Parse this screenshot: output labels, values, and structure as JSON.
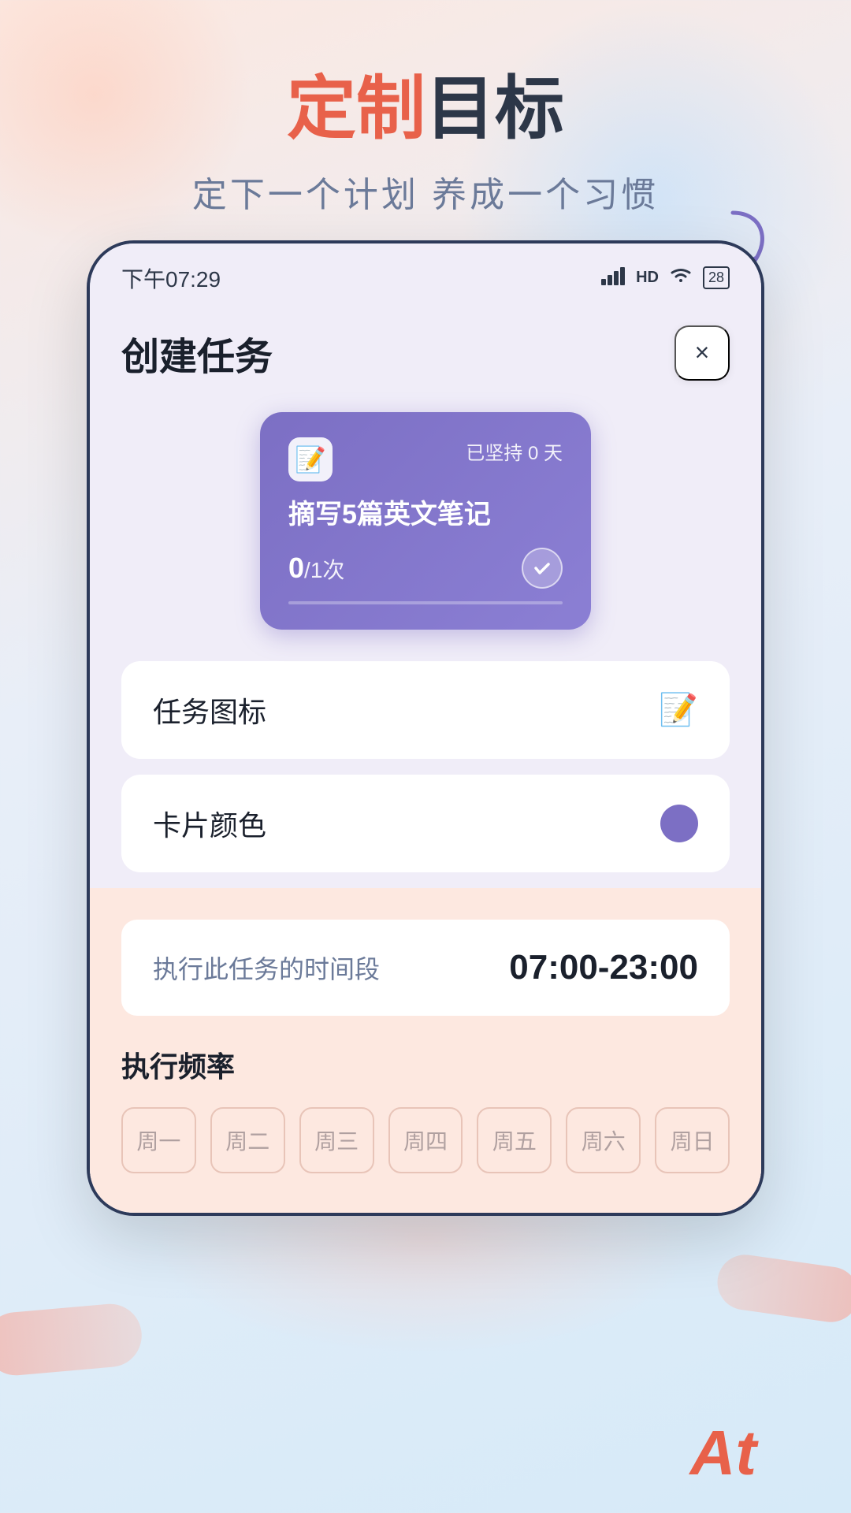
{
  "page": {
    "title_highlight": "定制",
    "title_dark": "目标",
    "subtitle": "定下一个计划 养成一个习惯"
  },
  "status_bar": {
    "time": "下午07:29",
    "signal": "HD",
    "battery": "28"
  },
  "app": {
    "title": "创建任务",
    "close_label": "×"
  },
  "task_card": {
    "streak_label": "已坚持",
    "streak_count": "0",
    "streak_unit": "天",
    "task_name": "摘写5篇英文笔记",
    "progress_current": "0",
    "progress_total": "1",
    "progress_unit": "次"
  },
  "settings": {
    "icon_row": {
      "label": "任务图标"
    },
    "color_row": {
      "label": "卡片颜色"
    }
  },
  "time_section": {
    "label": "执行此任务的时间段",
    "value": "07:00-23:00"
  },
  "frequency": {
    "title": "执行频率",
    "weekdays": [
      "周一",
      "周二",
      "周三",
      "周四",
      "周五",
      "周六",
      "周日"
    ]
  },
  "at_label": "At"
}
